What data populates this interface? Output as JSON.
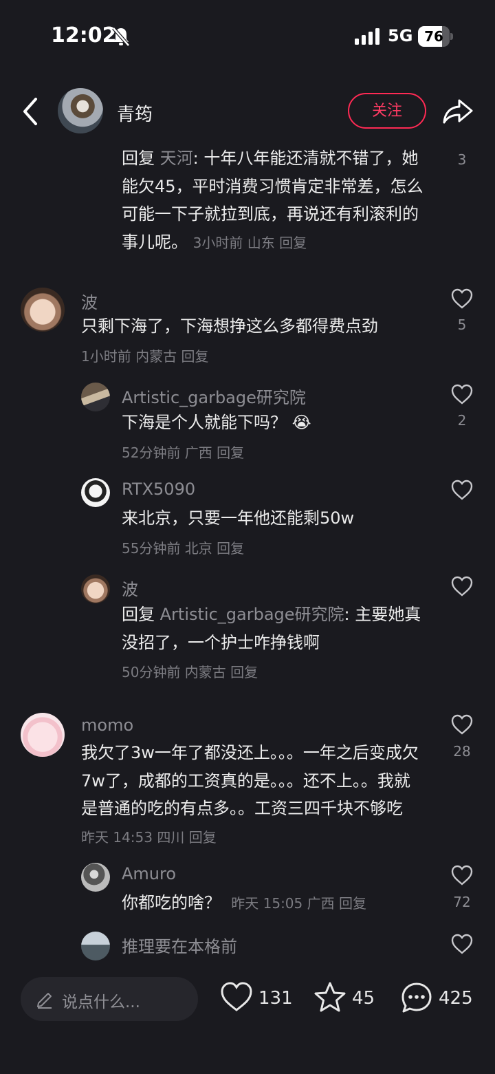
{
  "status_bar": {
    "time": "12:02",
    "network": "5G",
    "battery": "76",
    "battery_level": 0.76
  },
  "header": {
    "author": "青筠",
    "follow_label": "关注"
  },
  "comments": [
    {
      "prefix": "回复",
      "target": "天河",
      "body": ": 十年八年能还清就不错了，她能欠45，平时消费习惯肯定非常差，怎么可能一下子就拉到底，再说还有利滚利的事儿呢。",
      "meta": "3小时前 山东 回复",
      "likes": "3"
    },
    {
      "user": "波",
      "body": "只剩下海了，下海想挣这么多都得费点劲",
      "meta": "1小时前 内蒙古 回复",
      "likes": "5"
    },
    {
      "user": "Artistic_garbage研究院",
      "body": "下海是个人就能下吗？",
      "emoji": "😭",
      "meta": "52分钟前 广西 回复",
      "likes": "2"
    },
    {
      "user": "RTX5090",
      "body": "来北京，只要一年他还能剩50w",
      "meta": "55分钟前 北京 回复",
      "likes": ""
    },
    {
      "user": "波",
      "prefix": "回复",
      "target": "Artistic_garbage研究院",
      "body": ": 主要她真没招了，一个护士咋挣钱啊",
      "meta": "50分钟前 内蒙古 回复",
      "likes": ""
    },
    {
      "user": "momo",
      "body": "我欠了3w一年了都没还上。。。一年之后变成欠7w了，成都的工资真的是。。。还不上。。我就是普通的吃的有点多。。工资三四千块不够吃",
      "meta": "昨天 14:53 四川 回复",
      "likes": "28"
    },
    {
      "user": "Amuro",
      "body": "你都吃的啥？",
      "meta": "昨天 15:05 广西 回复",
      "likes": "72"
    },
    {
      "user": "推理要在本格前",
      "body": "",
      "meta": "",
      "likes": ""
    }
  ],
  "bottom_bar": {
    "input_placeholder": "说点什么...",
    "like_count": "131",
    "star_count": "45",
    "comment_count": "425"
  },
  "colors": {
    "background": "#1a1a1f",
    "accent": "#ff2a54",
    "muted": "#8d8d93"
  },
  "icons": [
    "back-icon",
    "share-icon",
    "heart-icon",
    "star-icon",
    "comment-bubble-icon",
    "pencil-icon",
    "mute-bell-icon",
    "signal-icon"
  ]
}
